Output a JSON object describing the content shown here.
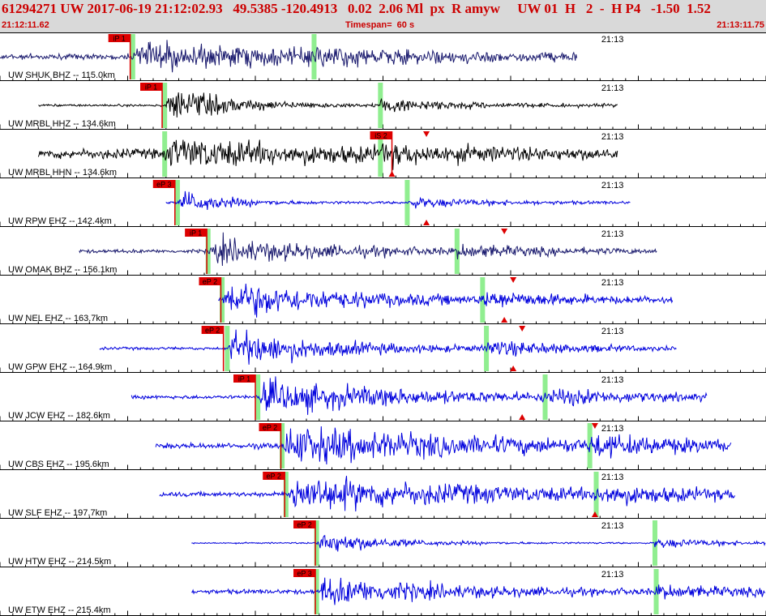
{
  "header": {
    "event_line": "61294271 UW 2017-06-19 21:12:02.93   49.5385 -120.4913   0.02  2.06 Ml  px  R amyw     UW 01  H   2  -  H P4   -1.50  1.52",
    "start_time": "21:12:11.62",
    "timespan": "Timespan=  60 s",
    "end_time": "21:13:11.75"
  },
  "colors": {
    "header_bg": "#d9d9d9",
    "header_text": "#cc0000",
    "pick": "#dd0000",
    "window": "#90ee90",
    "wave_navy": "#1a1a6e",
    "wave_black": "#000000",
    "wave_blue": "#0000dd"
  },
  "chart_data": {
    "type": "line",
    "x_range_seconds": [
      0,
      60
    ],
    "minute_label": "21:13",
    "minute_label_time_s": 47.1,
    "traces": [
      {
        "label": "UW SHUK BHZ -- 115.0km",
        "color": "wave_navy",
        "start_s": 0.0,
        "end_s": 45.2,
        "pick": "iP 1",
        "pick_s": 10.2,
        "onset_s": 10.4,
        "s_window_s": 24.6,
        "amp": 0.55,
        "noise": 0.12,
        "decay": 0.06
      },
      {
        "label": "UW MRBL HHZ -- 134.6km",
        "color": "wave_black",
        "start_s": 3.0,
        "end_s": 48.4,
        "pick": "iP 1",
        "pick_s": 12.7,
        "onset_s": 12.9,
        "s_window_s": 29.8,
        "amp": 0.8,
        "noise": 0.05,
        "decay": 0.2
      },
      {
        "label": "UW MRBL HHN -- 134.6km",
        "color": "wave_black",
        "start_s": 3.0,
        "end_s": 48.4,
        "pick": "iS 2",
        "pick_s": 30.7,
        "onset_s": 12.9,
        "s_window_s": 29.8,
        "amp": 0.55,
        "noise": 0.22,
        "decay": 0.08
      },
      {
        "label": "UW RPW EHZ -- 142.4km",
        "color": "wave_blue",
        "start_s": 13.0,
        "end_s": 49.4,
        "pick": "eP 3",
        "pick_s": 13.7,
        "onset_s": 13.9,
        "s_window_s": 31.9,
        "amp": 0.6,
        "noise": 0.05,
        "decay": 0.3
      },
      {
        "label": "UW OMAK BHZ -- 156.1km",
        "color": "wave_navy",
        "start_s": 6.2,
        "end_s": 51.5,
        "pick": "iP 1",
        "pick_s": 16.2,
        "onset_s": 16.3,
        "s_window_s": 35.8,
        "amp": 0.55,
        "noise": 0.08,
        "decay": 0.1
      },
      {
        "label": "UW NEL EHZ -- 163.7km",
        "color": "wave_blue",
        "start_s": 17.1,
        "end_s": 52.7,
        "pick": "eP 2",
        "pick_s": 17.3,
        "onset_s": 17.4,
        "s_window_s": 37.8,
        "amp": 0.8,
        "noise": 0.08,
        "decay": 0.1
      },
      {
        "label": "UW GPW EHZ -- 164.9km",
        "color": "wave_blue",
        "start_s": 7.8,
        "end_s": 53.0,
        "pick": "eP 2",
        "pick_s": 17.5,
        "onset_s": 17.8,
        "s_window_s": 38.1,
        "amp": 0.8,
        "noise": 0.06,
        "decay": 0.12
      },
      {
        "label": "UW JCW EHZ -- 182.6km",
        "color": "wave_blue",
        "start_s": 10.3,
        "end_s": 55.4,
        "pick": "iP 1",
        "pick_s": 20.0,
        "onset_s": 20.2,
        "s_window_s": 42.7,
        "amp": 0.7,
        "noise": 0.08,
        "decay": 0.08
      },
      {
        "label": "UW CBS EHZ -- 195.6km",
        "color": "wave_blue",
        "start_s": 12.2,
        "end_s": 57.3,
        "pick": "eP 2",
        "pick_s": 22.0,
        "onset_s": 22.1,
        "s_window_s": 46.2,
        "amp": 0.8,
        "noise": 0.12,
        "decay": 0.06
      },
      {
        "label": "UW SLF EHZ -- 197.7km",
        "color": "wave_blue",
        "start_s": 12.5,
        "end_s": 57.6,
        "pick": "eP 2",
        "pick_s": 22.3,
        "onset_s": 22.4,
        "s_window_s": 46.7,
        "amp": 0.75,
        "noise": 0.1,
        "decay": 0.06
      },
      {
        "label": "UW HTW EHZ -- 214.5km",
        "color": "wave_blue",
        "start_s": 15.0,
        "end_s": 60.0,
        "pick": "eP 2",
        "pick_s": 24.7,
        "onset_s": 24.8,
        "s_window_s": 51.3,
        "amp": 0.55,
        "noise": 0.03,
        "decay": 0.2
      },
      {
        "label": "UW ETW EHZ -- 215.4km",
        "color": "wave_blue",
        "start_s": 15.0,
        "end_s": 60.0,
        "pick": "eP 3",
        "pick_s": 24.7,
        "onset_s": 24.8,
        "s_window_s": 51.4,
        "amp": 0.6,
        "noise": 0.1,
        "decay": 0.1
      }
    ],
    "markers": [
      {
        "trace": 2,
        "time_s": 30.7,
        "shape": "up"
      },
      {
        "trace": 2,
        "time_s": 33.4,
        "shape": "down"
      },
      {
        "trace": 3,
        "time_s": 33.4,
        "shape": "up"
      },
      {
        "trace": 4,
        "time_s": 39.5,
        "shape": "down"
      },
      {
        "trace": 5,
        "time_s": 39.5,
        "shape": "up"
      },
      {
        "trace": 5,
        "time_s": 40.2,
        "shape": "down"
      },
      {
        "trace": 6,
        "time_s": 40.2,
        "shape": "up"
      },
      {
        "trace": 6,
        "time_s": 40.9,
        "shape": "down"
      },
      {
        "trace": 7,
        "time_s": 40.9,
        "shape": "up"
      },
      {
        "trace": 8,
        "time_s": 46.6,
        "shape": "down"
      },
      {
        "trace": 9,
        "time_s": 46.6,
        "shape": "up"
      }
    ]
  }
}
